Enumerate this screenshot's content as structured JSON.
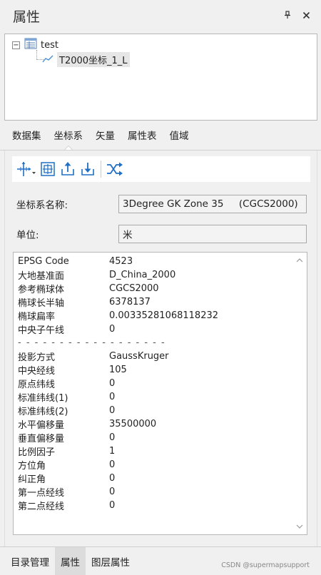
{
  "panel": {
    "title": "属性"
  },
  "tree": {
    "root_label": "test",
    "expander_symbol": "−",
    "child_label": "T2000坐标_1_L"
  },
  "tabs": [
    {
      "label": "数据集"
    },
    {
      "label": "坐标系"
    },
    {
      "label": "矢量"
    },
    {
      "label": "属性表"
    },
    {
      "label": "值域"
    }
  ],
  "active_tab": "坐标系",
  "fields": {
    "name_label": "坐标系名称:",
    "name_value": "3Degree GK Zone 35     (CGCS2000)",
    "unit_label": "单位:",
    "unit_value": "米"
  },
  "info_rows": [
    {
      "key": "EPSG Code",
      "value": "4523"
    },
    {
      "key": "大地基准面",
      "value": "D_China_2000"
    },
    {
      "key": "参考椭球体",
      "value": "CGCS2000"
    },
    {
      "key": "椭球长半轴",
      "value": "6378137"
    },
    {
      "key": "椭球扁率",
      "value": "0.00335281068118232"
    },
    {
      "key": "中央子午线",
      "value": "0"
    },
    {
      "key": "- - - - - - - - - - - - - - - - - -",
      "value": ""
    },
    {
      "key": "投影方式",
      "value": "GaussKruger"
    },
    {
      "key": "中央经线",
      "value": "105"
    },
    {
      "key": "原点纬线",
      "value": "0"
    },
    {
      "key": "标准纬线(1)",
      "value": "0"
    },
    {
      "key": "标准纬线(2)",
      "value": "0"
    },
    {
      "key": "水平偏移量",
      "value": "35500000"
    },
    {
      "key": "垂直偏移量",
      "value": "0"
    },
    {
      "key": "比例因子",
      "value": "1"
    },
    {
      "key": "方位角",
      "value": "0"
    },
    {
      "key": "纠正角",
      "value": "0"
    },
    {
      "key": "第一点经线",
      "value": "0"
    },
    {
      "key": "第二点经线",
      "value": "0"
    }
  ],
  "bottom_tabs": [
    {
      "label": "目录管理"
    },
    {
      "label": "属性"
    },
    {
      "label": "图层属性"
    }
  ],
  "active_bottom_tab": "属性",
  "watermark": "CSDN @supermapsupport",
  "colors": {
    "accent_blue": "#1f6fc5",
    "active_tab_bg": "#dcdcdc"
  }
}
